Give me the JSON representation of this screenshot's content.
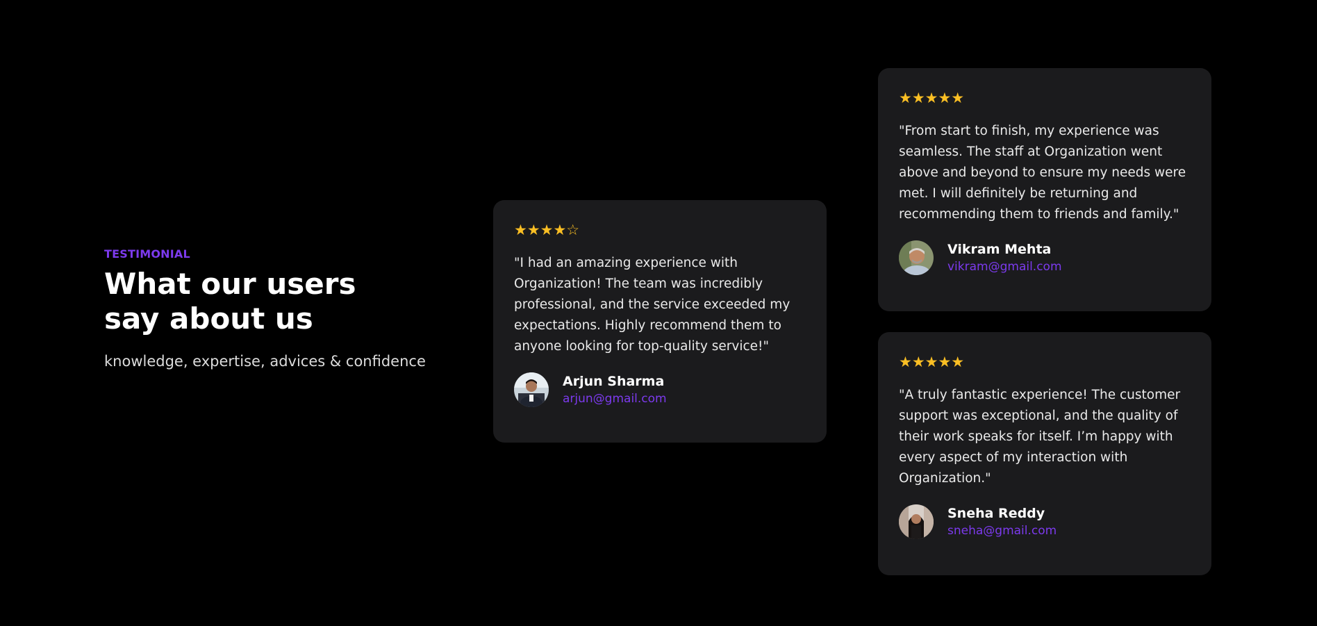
{
  "section": {
    "eyebrow": "TESTIMONIAL",
    "heading_line1": "What our users",
    "heading_line2": "say about us",
    "subtitle": "knowledge, expertise, advices & confidence"
  },
  "colors": {
    "background": "#000000",
    "card": "#1b1b1d",
    "accent": "#7c3aed",
    "star": "#fbbf24"
  },
  "testimonials": [
    {
      "stars": "★★★★☆",
      "rating": 4,
      "quote": "\"I had an amazing experience with Organization! The team was incredibly professional, and the service exceeded my expectations. Highly recommend them to anyone looking for top-quality service!\"",
      "name": "Arjun Sharma",
      "email": "arjun@gmail.com",
      "avatar_icon": "avatar-photo"
    },
    {
      "stars": "★★★★★",
      "rating": 5,
      "quote": "\"From start to finish, my experience was seamless. The staff at Organization went above and beyond to ensure my needs were met. I will definitely be returning and recommending them to friends and family.\"",
      "name": "Vikram Mehta",
      "email": "vikram@gmail.com",
      "avatar_icon": "avatar-photo"
    },
    {
      "stars": "★★★★★",
      "rating": 5,
      "quote": "\"A truly fantastic experience! The customer support was exceptional, and the quality of their work speaks for itself. I’m happy with every aspect of my interaction with Organization.\"",
      "name": "Sneha Reddy",
      "email": "sneha@gmail.com",
      "avatar_icon": "avatar-photo"
    }
  ]
}
